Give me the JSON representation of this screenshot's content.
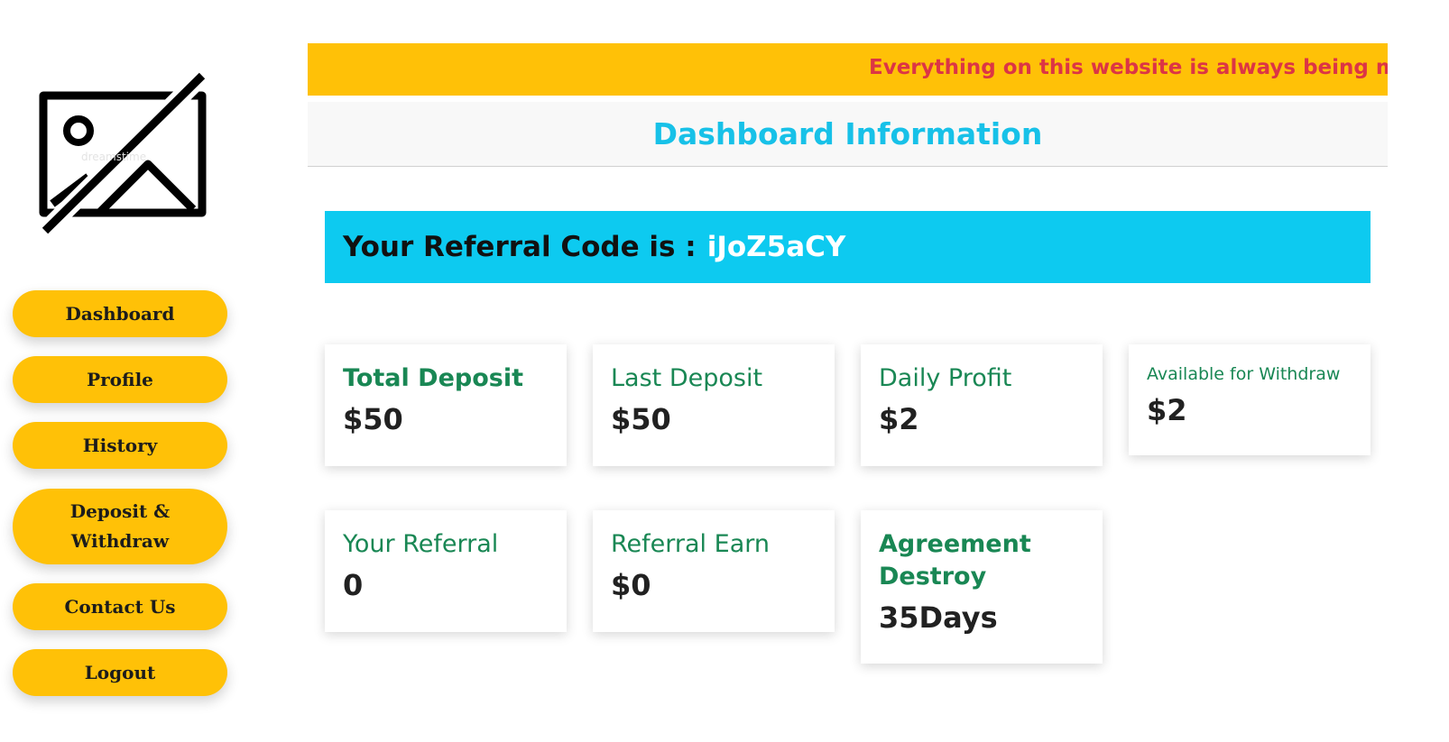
{
  "logo": {
    "icon": "image-unavailable-icon",
    "watermark": "dreamstime"
  },
  "sidebar": {
    "items": [
      {
        "label": "Dashboard"
      },
      {
        "label": "Profile"
      },
      {
        "label": "History"
      },
      {
        "label": "Deposit & Withdraw"
      },
      {
        "label": "Contact Us"
      },
      {
        "label": "Logout"
      }
    ]
  },
  "banner": {
    "text": "Everything on this website is always being monito"
  },
  "header": {
    "title": "Dashboard Information"
  },
  "referral": {
    "prefix": "Your Referral Code is :",
    "code": "iJoZ5aCY"
  },
  "cards": [
    {
      "label": "Total Deposit",
      "value": "$50"
    },
    {
      "label": "Last Deposit",
      "value": "$50"
    },
    {
      "label": "Daily Profit",
      "value": "$2"
    },
    {
      "label": "Available for Withdraw",
      "value": "$2"
    },
    {
      "label": "Your Referral",
      "value": "0"
    },
    {
      "label": "Referral Earn",
      "value": "$0"
    },
    {
      "label": "Agreement Destroy",
      "value": "35Days"
    }
  ],
  "colors": {
    "accent_yellow": "#ffc107",
    "banner_text": "#dc3545",
    "header_title": "#17c1e8",
    "referral_bg": "#0dcaf0",
    "card_label": "#198754"
  }
}
